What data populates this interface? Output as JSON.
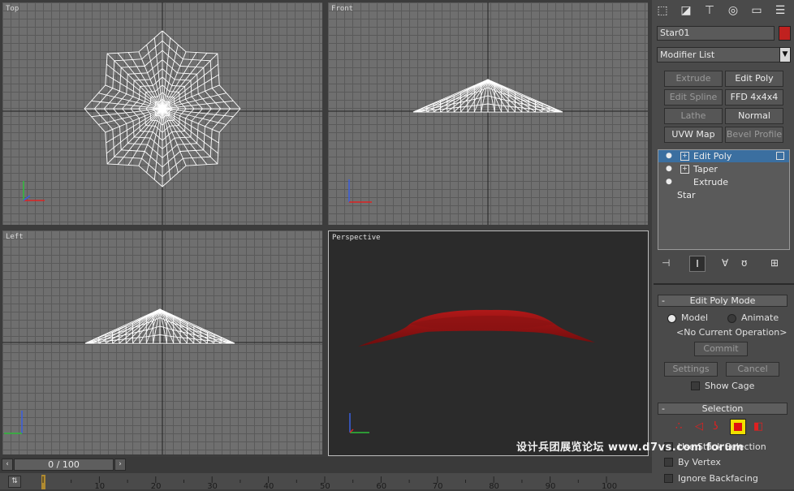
{
  "viewports": {
    "top": "Top",
    "front": "Front",
    "left": "Left",
    "perspective": "Perspective"
  },
  "command_panel": {
    "object_name": "Star01",
    "object_color": "#c0211f",
    "modifier_list": "Modifier List",
    "buttons": [
      {
        "label": "Extrude",
        "enabled": false
      },
      {
        "label": "Edit Poly",
        "enabled": true
      },
      {
        "label": "Edit Spline",
        "enabled": false
      },
      {
        "label": "FFD 4x4x4",
        "enabled": true
      },
      {
        "label": "Lathe",
        "enabled": false
      },
      {
        "label": "Normal",
        "enabled": true
      },
      {
        "label": "UVW Map",
        "enabled": true
      },
      {
        "label": "Bevel Profile",
        "enabled": false
      }
    ],
    "stack": [
      "Edit Poly",
      "Taper",
      "Extrude",
      "Star"
    ],
    "edit_poly_mode": {
      "title": "Edit Poly Mode",
      "model": "Model",
      "animate": "Animate",
      "operation": "<No Current Operation>",
      "commit": "Commit",
      "settings": "Settings",
      "cancel": "Cancel",
      "show_cage": "Show Cage"
    },
    "selection": {
      "title": "Selection",
      "use_stack": "Use Stack Selection",
      "by_vertex": "By Vertex",
      "ignore_backfacing": "Ignore Backfacing"
    }
  },
  "timeline": {
    "frame": "0 / 100",
    "ticks": [
      "10",
      "20",
      "30",
      "40",
      "50",
      "60",
      "70",
      "80",
      "90",
      "100"
    ]
  },
  "watermark": "设计兵团展览论坛 www.d7vs.com forum"
}
